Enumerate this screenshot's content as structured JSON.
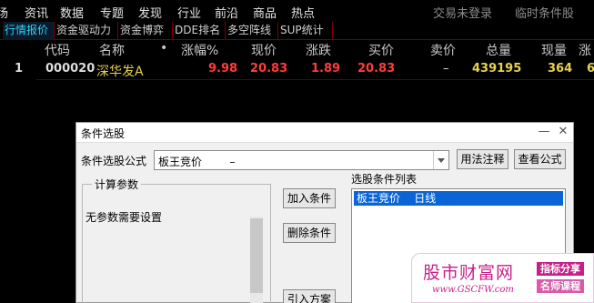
{
  "menu": {
    "items": [
      "场",
      "资讯",
      "数据",
      "专题",
      "发现",
      "行业",
      "前沿",
      "商品",
      "热点"
    ],
    "right_items": [
      "交易未登录",
      "临时条件股"
    ]
  },
  "tabs": [
    "行情报价",
    "资金驱动力",
    "资金博弈",
    "DDE排名",
    "多空阵线",
    "SUP统计"
  ],
  "quote_table": {
    "headers": [
      "代码",
      "名称",
      "•",
      "涨幅%",
      "现价",
      "涨跌",
      "买价",
      "卖价",
      "总量",
      "现量",
      "涨"
    ],
    "rows": [
      {
        "index": "1",
        "code": "000020",
        "name": "深华发A",
        "change_pct": "9.98",
        "price": "20.83",
        "change": "1.89",
        "bid": "20.83",
        "ask": "–",
        "volume": "439195",
        "current_vol": "364",
        "extra": "6"
      }
    ]
  },
  "dialog": {
    "title": "条件选股",
    "minimize": "—",
    "close": "✕",
    "formula_label": "条件选股公式",
    "formula_value": "板王竞价        –",
    "btn_notes": "用法注释",
    "btn_view_formula": "查看公式",
    "params_group_title": "计算参数",
    "params_text": "无参数需要设置",
    "btn_add_condition": "加入条件",
    "btn_delete_condition": "删除条件",
    "btn_import_plan": "引入方案",
    "condition_list_label": "选股条件列表",
    "condition_items": [
      "板王竞价    日线"
    ]
  },
  "watermark": {
    "title": "股市财富网",
    "url": "www.GSCFW.com",
    "badge1": "指标分享",
    "badge2": "名师课程"
  },
  "colors": {
    "red": "#ff3b3b",
    "yellow": "#e8d24a",
    "cyan": "#2ad4ff",
    "selection": "#0a64d6",
    "watermark": "#c8208a"
  }
}
